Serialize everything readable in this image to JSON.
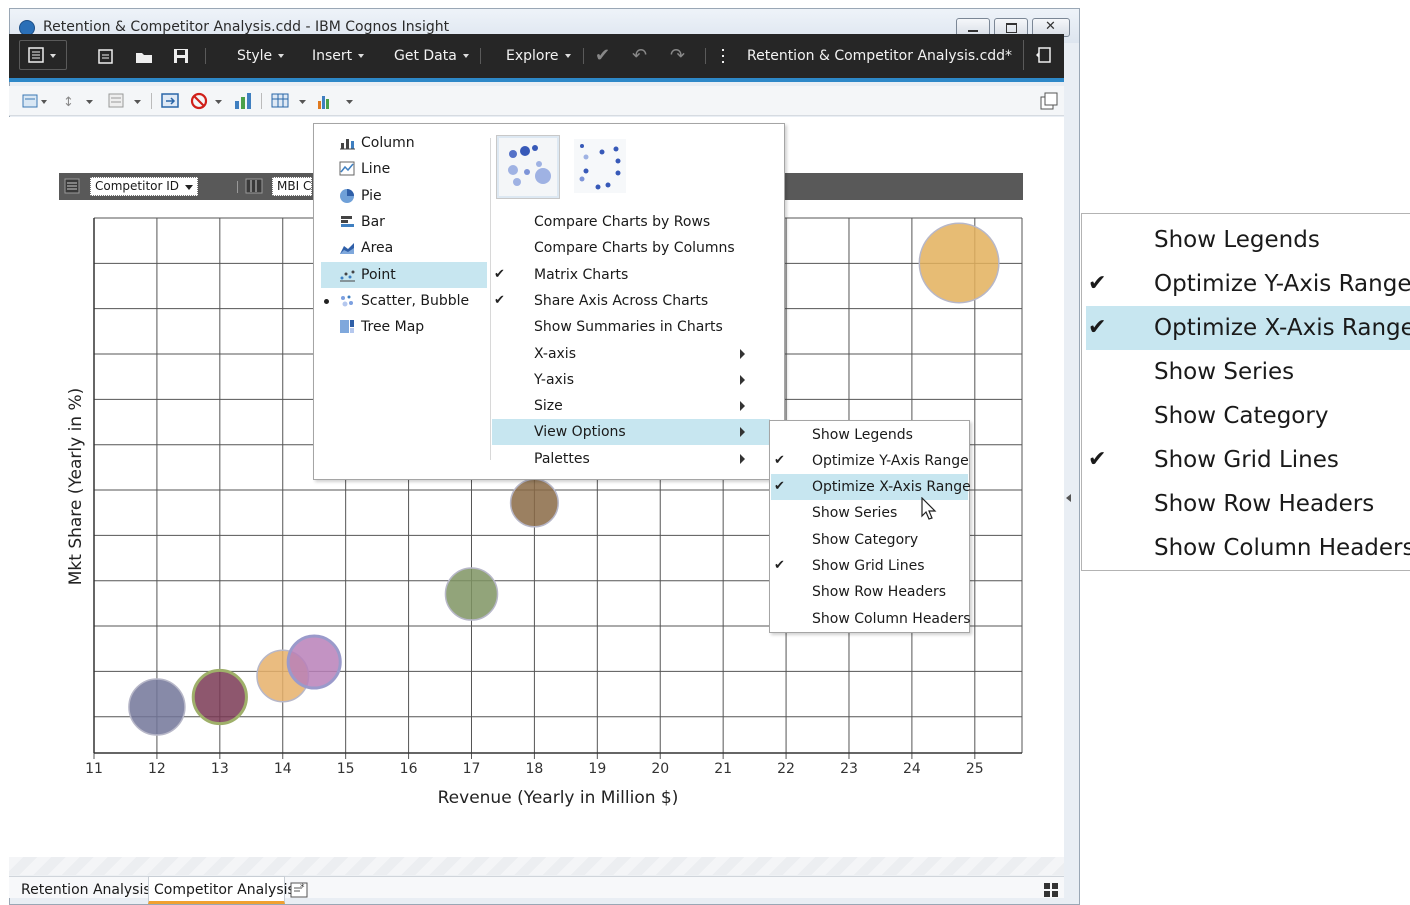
{
  "window": {
    "title": "Retention & Competitor Analysis.cdd - IBM Cognos Insight"
  },
  "toolbar": {
    "style_label": "Style",
    "insert_label": "Insert",
    "getdata_label": "Get Data",
    "explore_label": "Explore",
    "doc_name": "Retention & Competitor Analysis.cdd*"
  },
  "data_header": {
    "competitor_field": "Competitor ID",
    "mbi_field": "MBI C"
  },
  "chart_type_menu": {
    "items": [
      {
        "label": "Column",
        "icon": "column-chart-icon"
      },
      {
        "label": "Line",
        "icon": "line-chart-icon"
      },
      {
        "label": "Pie",
        "icon": "pie-chart-icon"
      },
      {
        "label": "Bar",
        "icon": "bar-chart-icon"
      },
      {
        "label": "Area",
        "icon": "area-chart-icon"
      },
      {
        "label": "Point",
        "icon": "point-chart-icon",
        "highlighted": true
      },
      {
        "label": "Scatter, Bubble",
        "icon": "scatter-chart-icon",
        "selected": true
      },
      {
        "label": "Tree Map",
        "icon": "treemap-chart-icon"
      }
    ]
  },
  "options_menu": {
    "items": [
      {
        "label": "Compare Charts by Rows"
      },
      {
        "label": "Compare Charts by Columns"
      },
      {
        "label": "Matrix Charts",
        "checked": true
      },
      {
        "label": "Share Axis Across Charts",
        "checked": true
      },
      {
        "label": "Show Summaries in Charts"
      },
      {
        "label": "X-axis",
        "submenu": true
      },
      {
        "label": "Y-axis",
        "submenu": true
      },
      {
        "label": "Size",
        "submenu": true
      },
      {
        "label": "View Options",
        "submenu": true,
        "highlighted": true
      },
      {
        "label": "Palettes",
        "submenu": true
      }
    ]
  },
  "view_options_menu": {
    "items": [
      {
        "label": "Show Legends",
        "checked": false
      },
      {
        "label": "Optimize Y-Axis Range",
        "checked": true
      },
      {
        "label": "Optimize X-Axis Range",
        "checked": true,
        "highlighted": true
      },
      {
        "label": "Show Series",
        "checked": false
      },
      {
        "label": "Show Category",
        "checked": false
      },
      {
        "label": "Show Grid Lines",
        "checked": true
      },
      {
        "label": "Show Row Headers",
        "checked": false
      },
      {
        "label": "Show Column Headers",
        "checked": false
      }
    ]
  },
  "tabs": [
    {
      "label": "Retention Analysis",
      "active": false
    },
    {
      "label": "Competitor Analysis",
      "active": true
    }
  ],
  "colors": {
    "toolbar_bg": "#262626",
    "accent": "#2d88c8",
    "highlight": "#c7e6f0",
    "active_tab_underline": "#f0a030"
  },
  "chart_data": {
    "type": "scatter",
    "xlabel": "Revenue (Yearly in Million $)",
    "ylabel": "Mkt Share (Yearly in %)",
    "x_ticks": [
      11,
      12,
      13,
      14,
      15,
      16,
      17,
      18,
      19,
      20,
      21,
      22,
      23,
      24,
      25
    ],
    "xlim": [
      11,
      25.75
    ],
    "grid": true,
    "points": [
      {
        "x": 12.0,
        "size": 1.0,
        "color": "#727599"
      },
      {
        "x": 13.0,
        "size": 0.95,
        "color": "#7a3a55"
      },
      {
        "x": 14.0,
        "size": 0.92,
        "color": "#e6b06a"
      },
      {
        "x": 14.5,
        "size": 0.93,
        "color": "#b880b9"
      },
      {
        "x": 17.0,
        "size": 0.93,
        "color": "#7f9463"
      },
      {
        "x": 18.0,
        "size": 0.85,
        "color": "#8a6a45"
      },
      {
        "x": 24.75,
        "size": 1.42,
        "color": "#e3b05c"
      }
    ]
  }
}
